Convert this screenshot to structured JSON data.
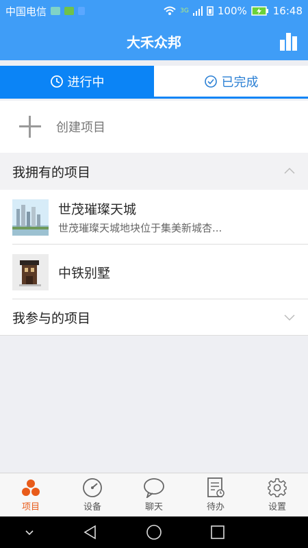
{
  "status": {
    "carrier": "中国电信",
    "battery": "100%",
    "time": "16:48",
    "network": "3G"
  },
  "header": {
    "title": "大禾众邦"
  },
  "tabs": [
    {
      "label": "进行中"
    },
    {
      "label": "已完成"
    }
  ],
  "create": {
    "label": "创建项目"
  },
  "owned": {
    "label": "我拥有的项目",
    "items": [
      {
        "name": "世茂璀璨天城",
        "desc": "世茂璀璨天城地块位于集美新城杏..."
      },
      {
        "name": "中铁别墅",
        "desc": ""
      }
    ]
  },
  "joined": {
    "label": "我参与的项目"
  },
  "bottom_tabs": [
    {
      "label": "项目",
      "icon": "project-icon"
    },
    {
      "label": "设备",
      "icon": "gauge-icon"
    },
    {
      "label": "聊天",
      "icon": "chat-icon"
    },
    {
      "label": "待办",
      "icon": "todo-icon"
    },
    {
      "label": "设置",
      "icon": "gear-icon"
    }
  ],
  "colors": {
    "primary": "#3f9df7",
    "tab_active": "#0b84f6",
    "bottom_active": "#e85b1a"
  }
}
